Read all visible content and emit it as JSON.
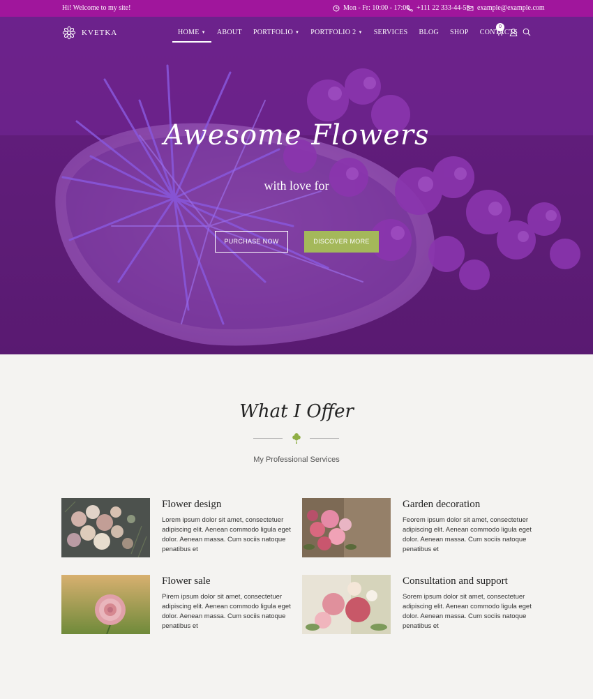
{
  "topbar": {
    "welcome": "Hi! Welcome to my site!",
    "hours": "Mon - Fr: 10:00 - 17:00",
    "phone": "+111 22 333-44-55",
    "email": "example@example.com"
  },
  "brand": {
    "name": "KVETKA"
  },
  "nav": {
    "items": [
      {
        "label": "HOME",
        "dropdown": true,
        "active": true
      },
      {
        "label": "ABOUT",
        "dropdown": false
      },
      {
        "label": "PORTFOLIO",
        "dropdown": true
      },
      {
        "label": "PORTFOLIO 2",
        "dropdown": true
      },
      {
        "label": "SERVICES",
        "dropdown": false
      },
      {
        "label": "BLOG",
        "dropdown": false
      },
      {
        "label": "SHOP",
        "dropdown": false
      },
      {
        "label": "CONTACTS",
        "dropdown": false
      }
    ],
    "cart_count": "0",
    "icons": [
      "cart-icon",
      "user-icon",
      "search-icon"
    ]
  },
  "hero": {
    "title": "Awesome Flowers",
    "subtitle": "with love for",
    "primary_button": "PURCHASE NOW",
    "secondary_button": "DISCOVER MORE"
  },
  "offer": {
    "title": "What I Offer",
    "subtitle": "My Professional Services",
    "services": [
      {
        "title": "Flower design",
        "text": "Lorem ipsum dolor sit amet, consectetuer adipiscing elit. Aenean commodo ligula eget dolor. Aenean massa. Cum sociis natoque penatibus et"
      },
      {
        "title": "Garden decoration",
        "text": "Feorem ipsum dolor sit amet, consectetuer adipiscing elit. Aenean commodo ligula eget dolor. Aenean massa. Cum sociis natoque penatibus et"
      },
      {
        "title": "Flower sale",
        "text": "Pirem ipsum dolor sit amet, consectetuer adipiscing elit. Aenean commodo ligula eget dolor. Aenean massa. Cum sociis natoque penatibus et"
      },
      {
        "title": "Consultation and support",
        "text": "Sorem ipsum dolor sit amet, consectetuer adipiscing elit. Aenean commodo ligula eget dolor. Aenean massa. Cum sociis natoque penatibus et"
      }
    ]
  },
  "colors": {
    "topbar": "#a0169c",
    "accent_green": "#a4b85a",
    "hero_purple": "#6a2590",
    "page_bg": "#f4f3f1"
  }
}
